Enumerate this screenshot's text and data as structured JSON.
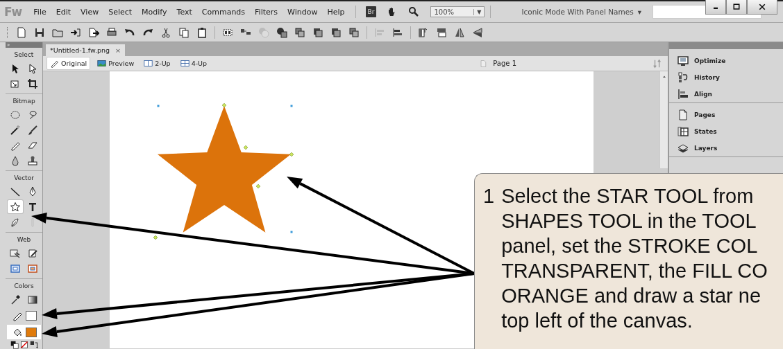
{
  "menubar": {
    "logo": "Fw",
    "menus": [
      "File",
      "Edit",
      "View",
      "Select",
      "Modify",
      "Text",
      "Commands",
      "Filters",
      "Window",
      "Help"
    ],
    "bridge_badge": "Br",
    "zoom": "100%",
    "zoom_caret": "▼",
    "workspace": "Iconic Mode With Panel Names",
    "workspace_caret": "▾"
  },
  "tools": {
    "grip": "»",
    "sections": [
      {
        "label": "Select",
        "tools": [
          {
            "selected": false
          },
          {
            "selected": false
          },
          {
            "selected": false
          },
          {
            "selected": false
          }
        ]
      },
      {
        "label": "Bitmap",
        "tools": [
          {
            "selected": false
          },
          {
            "selected": false
          },
          {
            "selected": false
          },
          {
            "selected": false
          },
          {
            "selected": false
          },
          {
            "selected": false
          },
          {
            "selected": false
          },
          {
            "selected": false
          }
        ]
      },
      {
        "label": "Vector",
        "tools": [
          {
            "selected": false
          },
          {
            "selected": false
          },
          {
            "selected": true
          },
          {
            "selected": false
          },
          {
            "selected": false
          },
          {
            "selected": false
          }
        ]
      },
      {
        "label": "Web",
        "tools": [
          {
            "selected": false
          },
          {
            "selected": false
          },
          {
            "selected": false
          },
          {
            "selected": false
          }
        ]
      },
      {
        "label": "Colors",
        "tools": [
          {
            "selected": false
          },
          {
            "selected": false
          }
        ],
        "swatches": [
          {
            "kind": "stroke",
            "color": "#ffffff",
            "selected": false
          },
          {
            "kind": "fill",
            "color": "#e07b0c",
            "selected": true
          }
        ]
      }
    ]
  },
  "document": {
    "tabs": [
      {
        "label": "*Untitled-1.fw.png",
        "close": "×",
        "selected": true
      }
    ],
    "view_modes": [
      {
        "label": "Original",
        "selected": true
      },
      {
        "label": "Preview",
        "selected": false
      },
      {
        "label": "2-Up",
        "selected": false
      },
      {
        "label": "4-Up",
        "selected": false
      }
    ],
    "page": "Page 1"
  },
  "panels": [
    {
      "items": [
        "Optimize",
        "History",
        "Align"
      ]
    },
    {
      "items": [
        "Pages",
        "States",
        "Layers"
      ]
    }
  ],
  "callout": {
    "number": "1",
    "text": "Select the STAR TOOL from\nSHAPES TOOL in the TOOL\npanel, set the STROKE COL\nTRANSPARENT, the FILL CO\nORANGE and draw a star ne\ntop left of the canvas."
  }
}
